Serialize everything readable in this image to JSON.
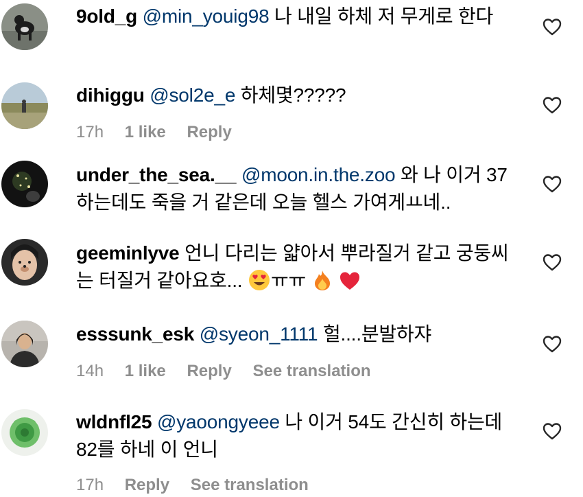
{
  "comments": [
    {
      "username": "9old_g",
      "mention": "@min_youig98",
      "text": "나 내일 하체 저 무게로 한다",
      "time": "",
      "likes": "",
      "reply": "",
      "translate": ""
    },
    {
      "username": "dihiggu",
      "mention": "@sol2e_e",
      "text": "하체몇?????",
      "time": "17h",
      "likes": "1 like",
      "reply": "Reply",
      "translate": ""
    },
    {
      "username": "under_the_sea.__",
      "mention": "@moon.in.the.zoo",
      "text": "와 나 이거 37 하는데도 죽을 거 같은데 오늘 헬스 가여게ㅛ네..",
      "time": "",
      "likes": "",
      "reply": "",
      "translate": ""
    },
    {
      "username": "geeminlyve",
      "mention": "",
      "text": "언니 다리는 얇아서 뿌라질거 같고 궁둥씨는 터질거 같아요호...",
      "text_tail": "ㅠㅠ",
      "time": "",
      "likes": "",
      "reply": "",
      "translate": ""
    },
    {
      "username": "esssunk_esk",
      "mention": "@syeon_1111",
      "text": "헐....분발하쟈",
      "time": "14h",
      "likes": "1 like",
      "reply": "Reply",
      "translate": "See translation"
    },
    {
      "username": "wldnfl25",
      "mention": "@yaoongyeee",
      "text": "나 이거 54도 간신히 하는데 82를 하네 이 언니",
      "time": "17h",
      "likes": "",
      "reply": "Reply",
      "translate": "See translation"
    }
  ],
  "icons": {
    "like": "heart-outline-icon",
    "emoji_1": "heart-eyes-emoji",
    "emoji_2": "fire-emoji",
    "emoji_3": "red-heart-emoji"
  },
  "colors": {
    "username": "#000000",
    "mention": "#00376b",
    "meta": "#8e8e8e"
  }
}
